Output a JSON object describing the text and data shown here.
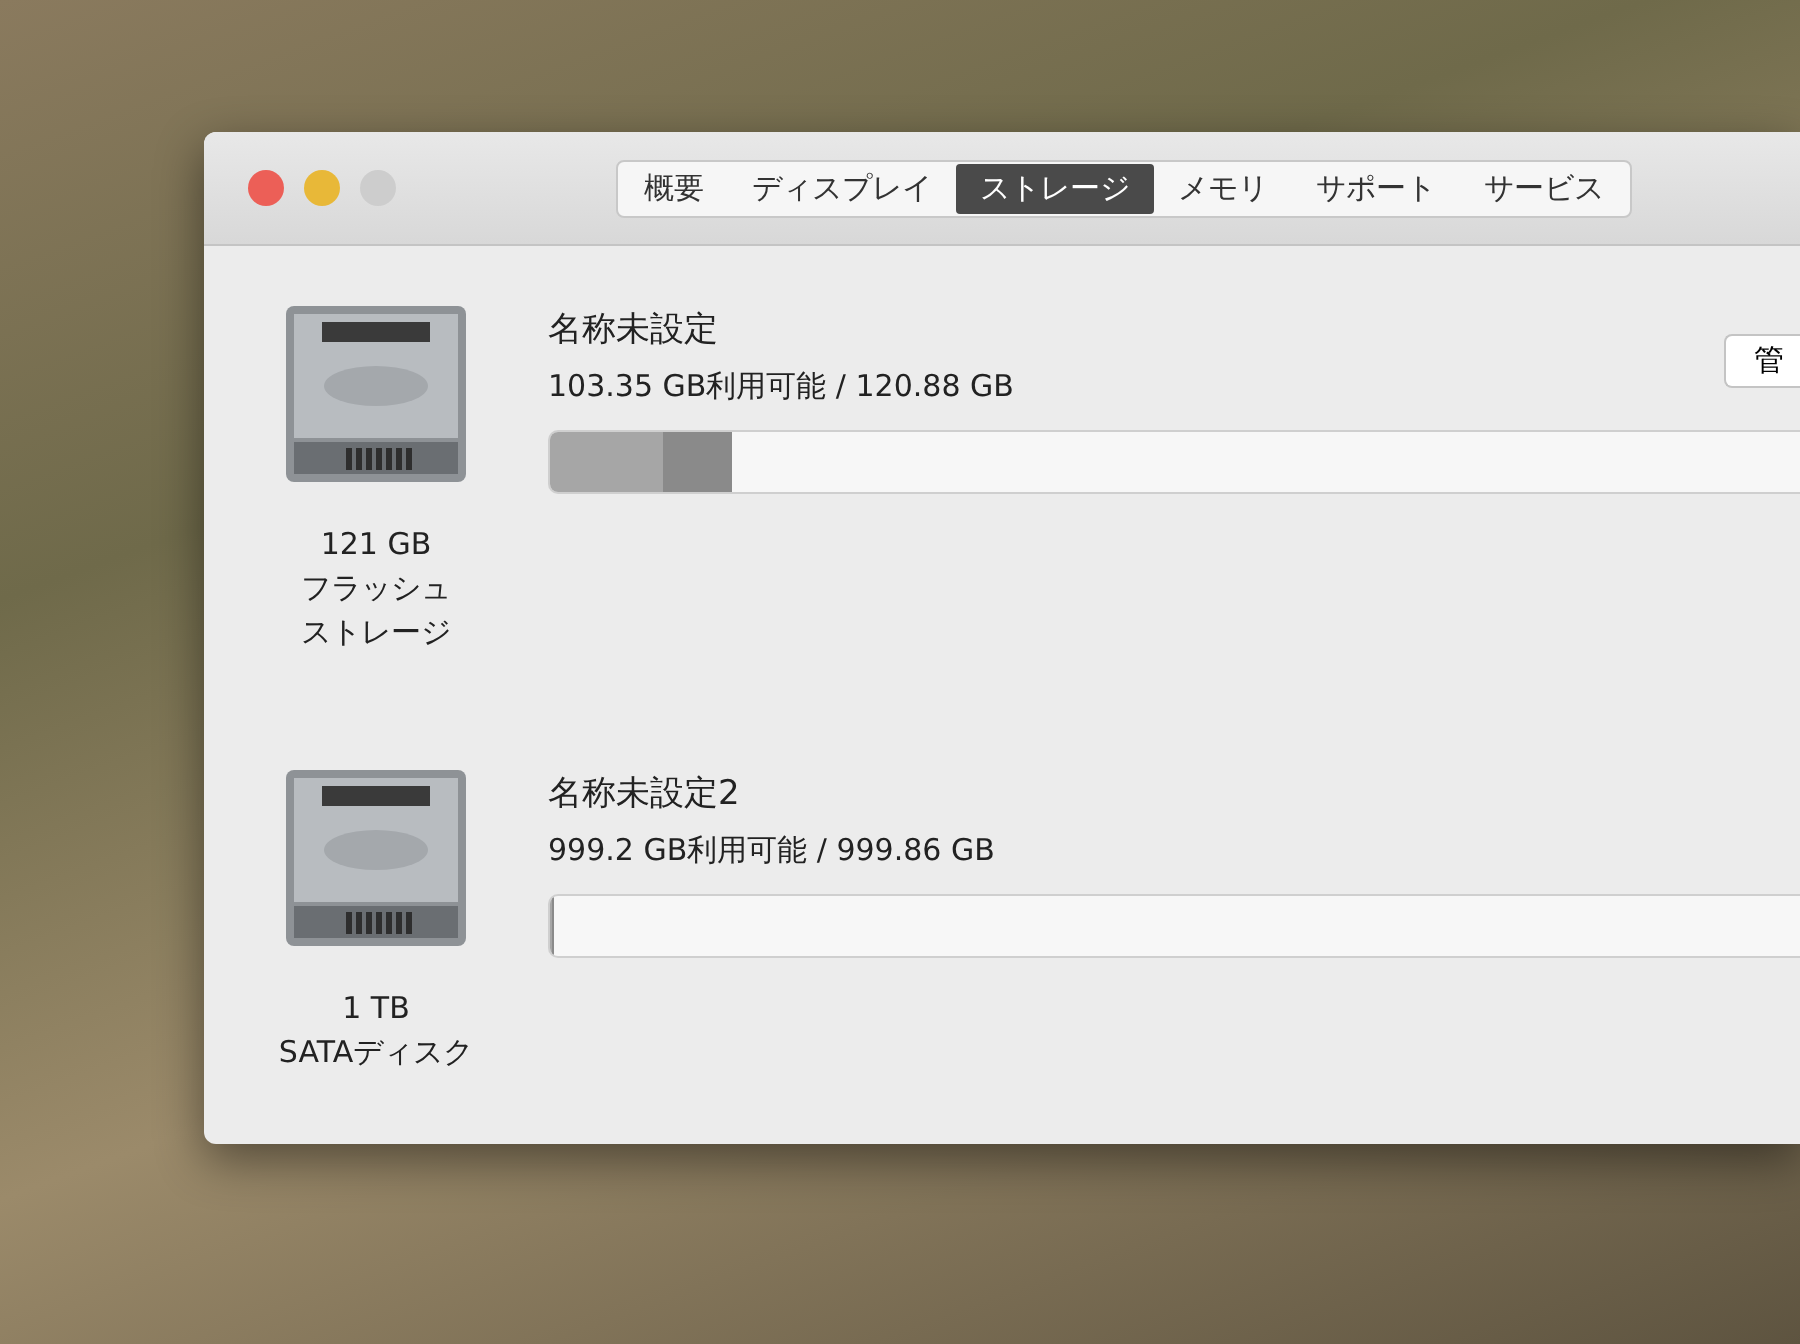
{
  "window": {
    "tabs": [
      {
        "label": "概要",
        "selected": false
      },
      {
        "label": "ディスプレイ",
        "selected": false
      },
      {
        "label": "ストレージ",
        "selected": true
      },
      {
        "label": "メモリ",
        "selected": false
      },
      {
        "label": "サポート",
        "selected": false
      },
      {
        "label": "サービス",
        "selected": false
      }
    ]
  },
  "drives": [
    {
      "size": "121 GB",
      "type_lines": [
        "フラッシュ",
        "ストレージ"
      ],
      "name": "名称未設定",
      "usage": "103.35 GB利用可能 / 120.88 GB",
      "level": 0.145,
      "button": "管"
    },
    {
      "size": "1 TB",
      "type_lines": [
        "SATAディスク"
      ],
      "name": "名称未設定2",
      "usage": "999.2 GB利用可能 / 999.86 GB",
      "level": 0.002
    }
  ]
}
